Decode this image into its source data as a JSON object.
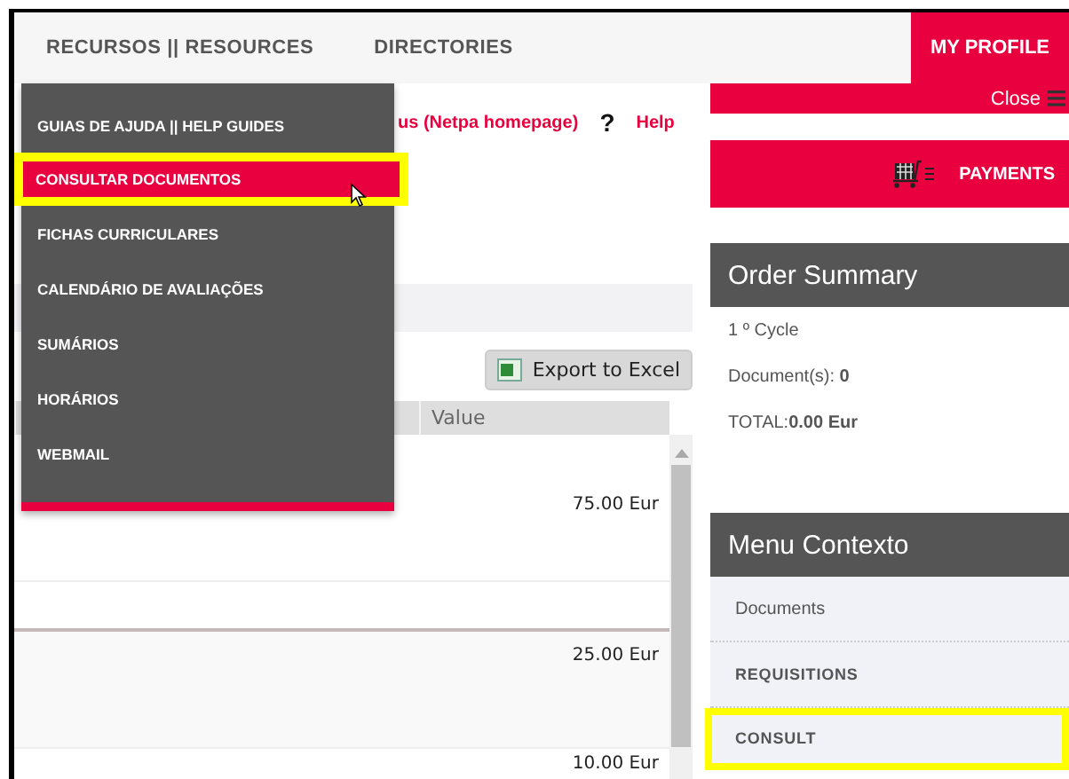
{
  "nav": {
    "items": [
      "RECURSOS || RESOURCES",
      "DIRECTORIES"
    ],
    "profile": "MY PROFILE"
  },
  "dropdown": {
    "items": [
      {
        "label": "GUIAS DE AJUDA || HELP GUIDES",
        "selected": false
      },
      {
        "label": "CONSULTAR DOCUMENTOS",
        "selected": true
      },
      {
        "label": "FICHAS CURRICULARES",
        "selected": false
      },
      {
        "label": "CALENDÁRIO DE AVALIAÇÕES",
        "selected": false
      },
      {
        "label": "SUMÁRIOS",
        "selected": false
      },
      {
        "label": "HORÁRIOS",
        "selected": false
      },
      {
        "label": "WEBMAIL",
        "selected": false
      }
    ]
  },
  "links": {
    "home": "us (Netpa homepage)",
    "help_mark": "?",
    "help": "Help"
  },
  "export_button": "Export to Excel",
  "table": {
    "columns": [
      "Value"
    ],
    "rows": [
      {
        "value": "75.00 Eur"
      },
      {
        "value": "25.00 Eur"
      },
      {
        "value": "10.00 Eur"
      }
    ]
  },
  "sidebar": {
    "close": "Close",
    "payments": "PAYMENTS",
    "order_summary": {
      "title": "Order Summary",
      "cycle": "1 º Cycle",
      "documents_label": "Document(s):",
      "documents": "0",
      "total_label": "TOTAL:",
      "total": "0.00 Eur"
    },
    "menu": {
      "title": "Menu Contexto",
      "items": [
        {
          "label": "Documents",
          "kind": "link",
          "selected": false
        },
        {
          "label": "REQUISITIONS",
          "kind": "heading",
          "selected": false
        },
        {
          "label": "CONSULT",
          "kind": "heading",
          "selected": true
        }
      ]
    }
  }
}
